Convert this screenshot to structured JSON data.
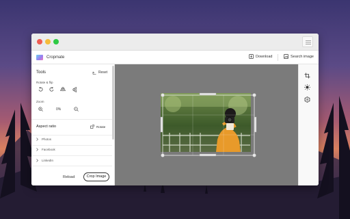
{
  "app": {
    "name": "Cropmate"
  },
  "header": {
    "download_label": "Download",
    "search_label": "Search image"
  },
  "tools": {
    "title": "Tools",
    "reset_label": "Reset",
    "rotate_flip_label": "Rotate & flip",
    "zoom_label": "Zoom",
    "zoom_value": "0%"
  },
  "aspect": {
    "title": "Aspect ratio",
    "rotate_label": "Rotate",
    "items": [
      {
        "label": "Photos"
      },
      {
        "label": "Facebook"
      },
      {
        "label": "LinkedIn"
      }
    ]
  },
  "footer": {
    "reload_label": "Reload",
    "crop_label": "Crop Image"
  },
  "colors": {
    "accent": "#4a90e2",
    "canvas_bg": "#7b7b7b",
    "subject_sweater": "#e89a2a"
  },
  "icons": [
    "crop-icon",
    "brightness-icon",
    "filter-icon",
    "download-icon",
    "search-image-icon",
    "hamburger-icon"
  ]
}
